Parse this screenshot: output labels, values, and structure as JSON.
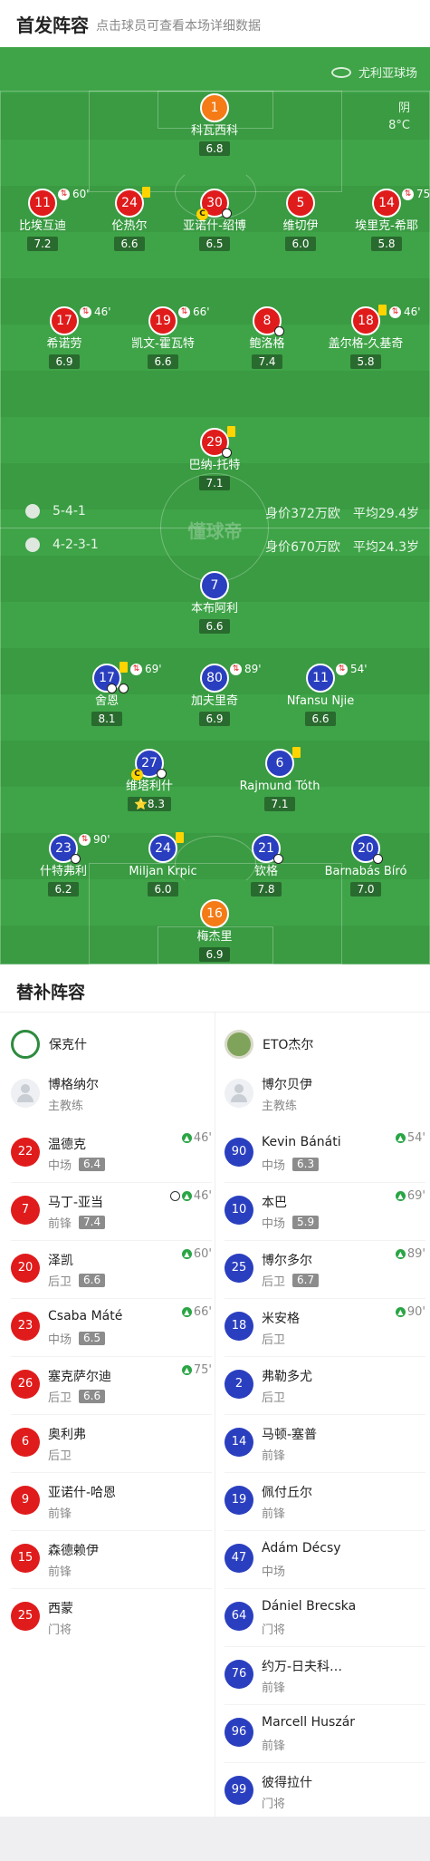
{
  "header": {
    "title": "首发阵容",
    "subtitle": "点击球员可查看本场详细数据"
  },
  "venue": "尤利亚球场",
  "weather": {
    "condition": "阴",
    "temp": "8°C"
  },
  "watermark": "懂球帝",
  "home_form": {
    "formation": "5-4-1",
    "value": "身价372万欧",
    "avg_age": "平均29.4岁"
  },
  "away_form": {
    "formation": "4-2-3-1",
    "value": "身价670万欧",
    "avg_age": "平均24.3岁"
  },
  "home_players": [
    {
      "num": "1",
      "name": "科瓦西科",
      "rating": "6.8"
    },
    {
      "num": "11",
      "name": "比埃互迪",
      "rating": "7.2",
      "sub": "60'"
    },
    {
      "num": "24",
      "name": "伦热尔",
      "rating": "6.6"
    },
    {
      "num": "30",
      "name": "亚诺什-绍博",
      "rating": "6.5"
    },
    {
      "num": "5",
      "name": "维切伊",
      "rating": "6.0"
    },
    {
      "num": "14",
      "name": "埃里克-希耶",
      "rating": "5.8",
      "sub": "75'"
    },
    {
      "num": "17",
      "name": "希诺劳",
      "rating": "6.9",
      "sub": "46'"
    },
    {
      "num": "19",
      "name": "凯文-霍瓦特",
      "rating": "6.6",
      "sub": "66'"
    },
    {
      "num": "8",
      "name": "鲍洛格",
      "rating": "7.4"
    },
    {
      "num": "18",
      "name": "盖尔格-久基奇",
      "rating": "5.8",
      "sub": "46'"
    },
    {
      "num": "29",
      "name": "巴纳-托特",
      "rating": "7.1"
    }
  ],
  "away_players": [
    {
      "num": "7",
      "name": "本布阿利",
      "rating": "6.6"
    },
    {
      "num": "17",
      "name": "舍恩",
      "rating": "8.1",
      "sub": "69'"
    },
    {
      "num": "80",
      "name": "加夫里奇",
      "rating": "6.9",
      "sub": "89'"
    },
    {
      "num": "11",
      "name": "Nfansu Njie",
      "rating": "6.6",
      "sub": "54'"
    },
    {
      "num": "27",
      "name": "维塔利什",
      "rating": "8.3"
    },
    {
      "num": "6",
      "name": "Rajmund Tóth",
      "rating": "7.1"
    },
    {
      "num": "23",
      "name": "什特弗利",
      "rating": "6.2",
      "sub": "90'"
    },
    {
      "num": "24",
      "name": "Miljan Krpic",
      "rating": "6.0"
    },
    {
      "num": "21",
      "name": "钦格",
      "rating": "7.8"
    },
    {
      "num": "20",
      "name": "Barnabás Bíró",
      "rating": "7.0"
    },
    {
      "num": "16",
      "name": "梅杰里",
      "rating": "6.9"
    }
  ],
  "subs": {
    "title": "替补阵容",
    "home_team": "保克什",
    "away_team": "ETO杰尔",
    "home_coach": {
      "name": "博格纳尔",
      "role": "主教练"
    },
    "away_coach": {
      "name": "博尔贝伊",
      "role": "主教练"
    },
    "home": [
      {
        "num": "22",
        "name": "温德克",
        "pos": "中场",
        "rating": "6.4",
        "on": "46'"
      },
      {
        "num": "7",
        "name": "马丁-亚当",
        "pos": "前锋",
        "rating": "7.4",
        "on": "46'"
      },
      {
        "num": "20",
        "name": "泽凯",
        "pos": "后卫",
        "rating": "6.6",
        "on": "60'"
      },
      {
        "num": "23",
        "name": "Csaba Máté",
        "pos": "中场",
        "rating": "6.5",
        "on": "66'"
      },
      {
        "num": "26",
        "name": "塞克萨尔迪",
        "pos": "后卫",
        "rating": "6.6",
        "on": "75'"
      },
      {
        "num": "6",
        "name": "奥利弗",
        "pos": "后卫"
      },
      {
        "num": "9",
        "name": "亚诺什-哈恩",
        "pos": "前锋"
      },
      {
        "num": "15",
        "name": "森德赖伊",
        "pos": "前锋"
      },
      {
        "num": "25",
        "name": "西蒙",
        "pos": "门将"
      }
    ],
    "away": [
      {
        "num": "90",
        "name": "Kevin Bánáti",
        "pos": "中场",
        "rating": "6.3",
        "on": "54'"
      },
      {
        "num": "10",
        "name": "本巴",
        "pos": "中场",
        "rating": "5.9",
        "on": "69'"
      },
      {
        "num": "25",
        "name": "博尔多尔",
        "pos": "后卫",
        "rating": "6.7",
        "on": "89'"
      },
      {
        "num": "18",
        "name": "米安格",
        "pos": "后卫",
        "on": "90'"
      },
      {
        "num": "2",
        "name": "弗勒多尤",
        "pos": "后卫"
      },
      {
        "num": "14",
        "name": "马顿-塞普",
        "pos": "前锋"
      },
      {
        "num": "19",
        "name": "佩付丘尔",
        "pos": "前锋"
      },
      {
        "num": "47",
        "name": "Ádám Décsy",
        "pos": "中场"
      },
      {
        "num": "64",
        "name": "Dániel Brecska",
        "pos": "门将"
      },
      {
        "num": "76",
        "name": "约万-日夫科…",
        "pos": "前锋"
      },
      {
        "num": "96",
        "name": "Marcell Huszár",
        "pos": "前锋"
      },
      {
        "num": "99",
        "name": "彼得拉什",
        "pos": "门将"
      }
    ]
  },
  "colors": {
    "pitch": "#3a9b42",
    "home": "#e01b1b",
    "away": "#2a3fbf",
    "keeper_home": "#f47b16",
    "keeper_away": "#f47b16",
    "card": "#ffd400"
  }
}
